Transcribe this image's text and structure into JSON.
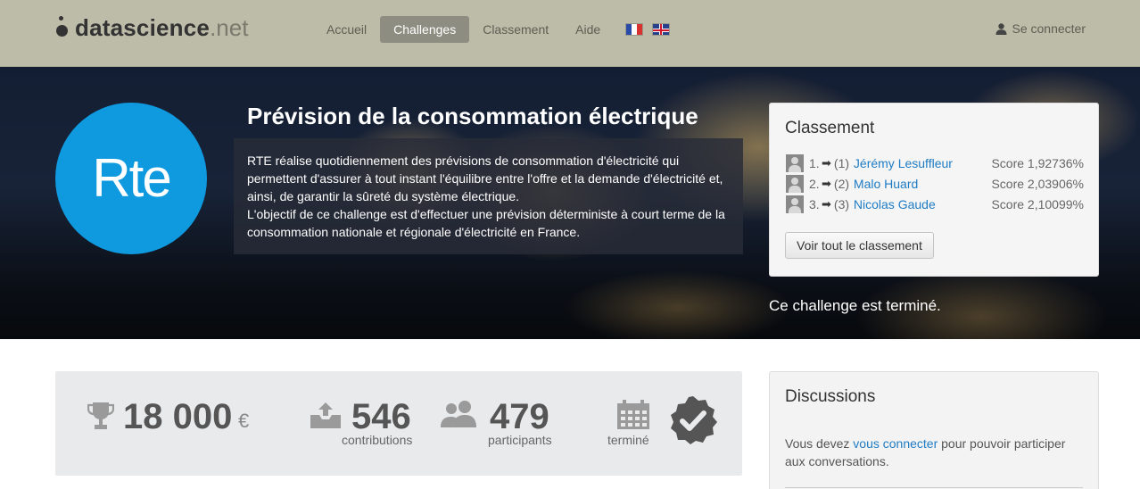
{
  "brand": {
    "name": "datascience",
    "tld": ".net"
  },
  "nav": {
    "items": [
      {
        "label": "Accueil",
        "active": false
      },
      {
        "label": "Challenges",
        "active": true
      },
      {
        "label": "Classement",
        "active": false
      },
      {
        "label": "Aide",
        "active": false
      }
    ],
    "login_label": "Se connecter"
  },
  "hero": {
    "logo_text": "Rte",
    "title": "Prévision de la consommation électrique",
    "description_1": "RTE réalise quotidiennement des prévisions de consommation d'électricité qui permettent d'assurer à tout instant l'équilibre entre l'offre et la demande d'électricité et, ainsi, de garantir la sûreté du système électrique.",
    "description_2": "L'objectif de ce challenge est d'effectuer une prévision déterministe à court terme de la consommation nationale et régionale d'électricité en France.",
    "status": "Ce challenge est terminé."
  },
  "ranking": {
    "title": "Classement",
    "rows": [
      {
        "position": "1.",
        "previous": "(1)",
        "name": "Jérémy Lesuffleur",
        "score": "Score 1,92736%"
      },
      {
        "position": "2.",
        "previous": "(2)",
        "name": "Malo Huard",
        "score": "Score 2,03906%"
      },
      {
        "position": "3.",
        "previous": "(3)",
        "name": "Nicolas Gaude",
        "score": "Score 2,10099%"
      }
    ],
    "button_label": "Voir tout le classement"
  },
  "stats": {
    "prize": "18 000",
    "currency": "€",
    "contributions": "546",
    "contributions_label": "contributions",
    "participants": "479",
    "participants_label": "participants",
    "status_label": "terminé"
  },
  "discussions": {
    "title": "Discussions",
    "text_before": "Vous devez ",
    "link": "vous connecter",
    "text_after": " pour pouvoir participer aux conversations."
  },
  "colors": {
    "navbar": "#bdbca9",
    "active_tab": "#8e8d81",
    "rte_blue": "#0f9ae0",
    "link": "#1f7cc4"
  }
}
